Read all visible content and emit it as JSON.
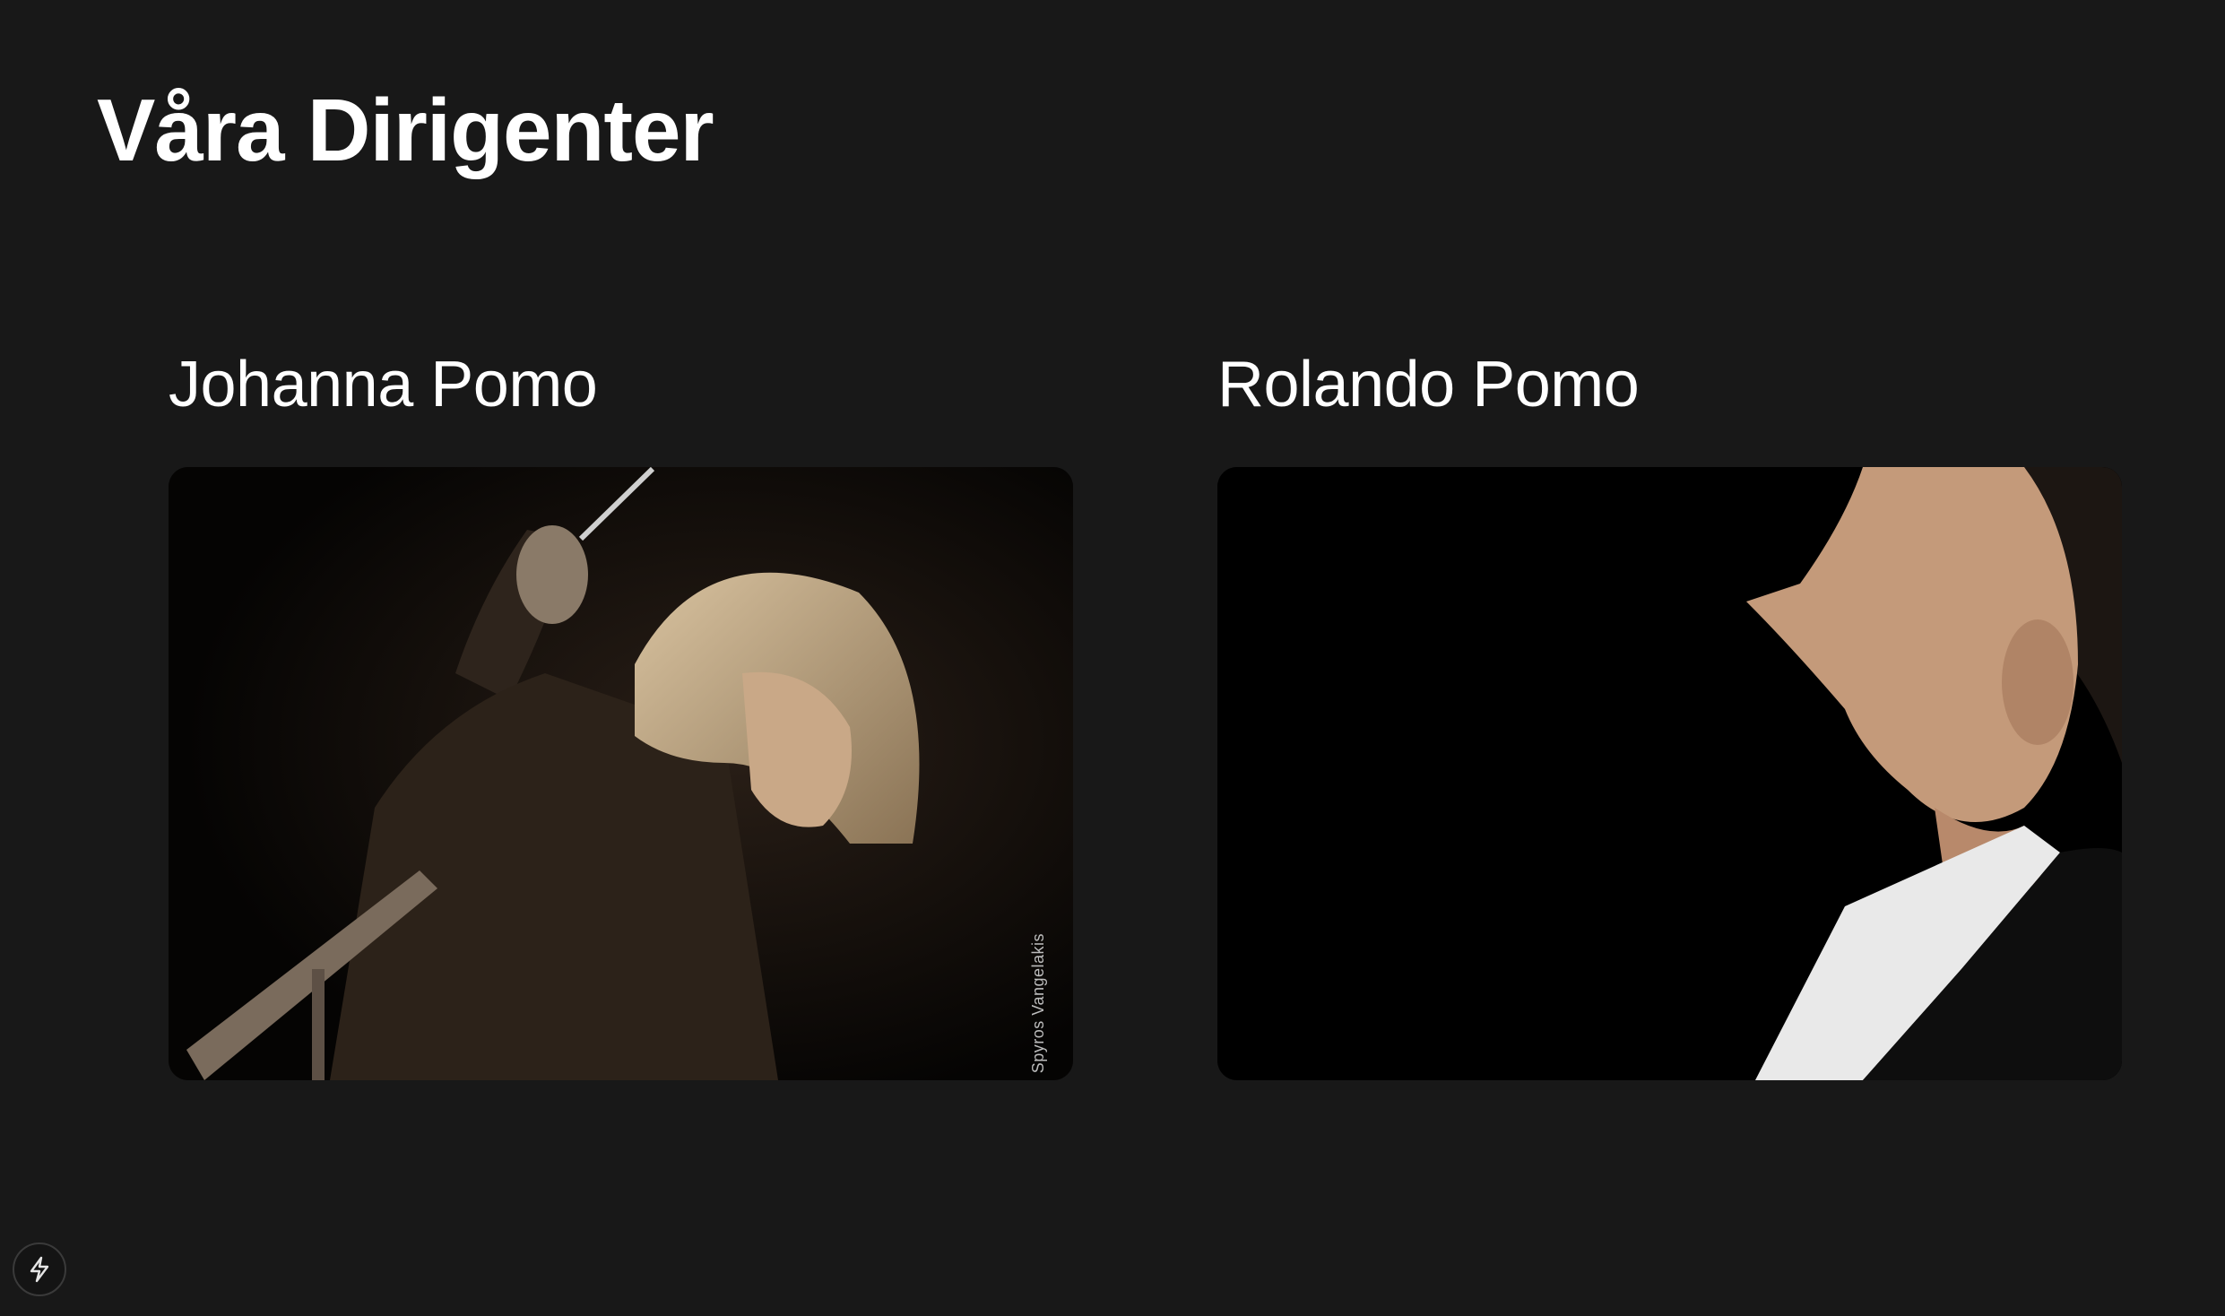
{
  "page": {
    "title": "Våra Dirigenter"
  },
  "conductors": [
    {
      "name": "Johanna Pomo",
      "photo_credit": "Spyros Vangelakis"
    },
    {
      "name": "Rolando Pomo"
    }
  ],
  "dev_badge": {
    "icon": "lightning-icon"
  },
  "colors": {
    "background": "#181818",
    "text": "#ffffff",
    "photo_bg": "#050505"
  }
}
